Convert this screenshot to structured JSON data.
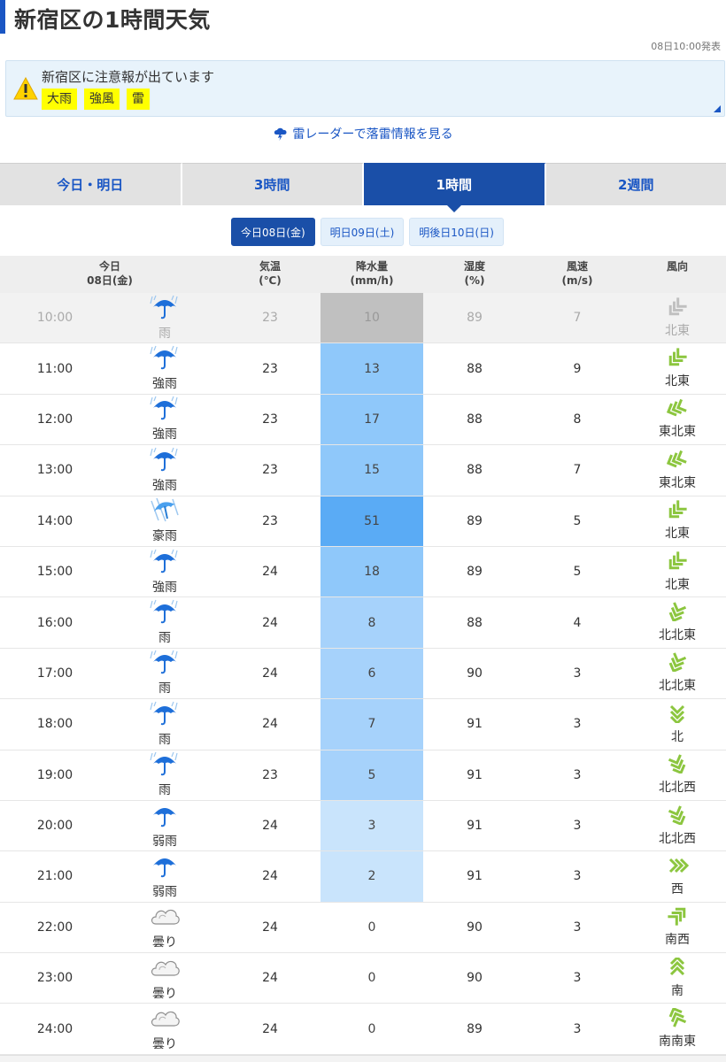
{
  "page": {
    "title": "新宿区の1時間天気",
    "issued": "08日10:00発表"
  },
  "alert": {
    "title": "新宿区に注意報が出ています",
    "tags": [
      "大雨",
      "強風",
      "雷"
    ]
  },
  "radar_link": "雷レーダーで落雷情報を見る",
  "tabs": [
    {
      "label": "今日・明日",
      "active": false
    },
    {
      "label": "3時間",
      "active": false
    },
    {
      "label": "1時間",
      "active": true
    },
    {
      "label": "2週間",
      "active": false
    }
  ],
  "days": [
    {
      "label": "今日08日(金)",
      "active": true
    },
    {
      "label": "明日09日(土)",
      "active": false
    },
    {
      "label": "明後日10日(日)",
      "active": false
    }
  ],
  "headers": {
    "time": "今日\n08日(金)",
    "temp": "気温\n(℃)",
    "precip": "降水量\n(mm/h)",
    "humidity": "湿度\n(%)",
    "wind_speed": "風速\n(m/s)",
    "wind_dir": "風向"
  },
  "colors": {
    "accent": "#1a56c4",
    "tab_active": "#1a4fa8",
    "alert_bg": "#e8f3fb",
    "tag_bg": "#ffff00",
    "precip_past": "#c0c0c0",
    "precip_heavy": "#5aabf5",
    "precip_strong": "#8fc8fa",
    "precip_medium": "#a6d2fb",
    "precip_light": "#c9e4fc",
    "wind_icon": "#8cc63f"
  },
  "rows": [
    {
      "time": "10:00",
      "weather": "雨",
      "icon": "umbrella-rain-icon",
      "temp": "23",
      "precip": "10",
      "humidity": "89",
      "wind_speed": "7",
      "wind_dir": "北東",
      "past": true
    },
    {
      "time": "11:00",
      "weather": "強雨",
      "icon": "umbrella-rain-icon",
      "temp": "23",
      "precip": "13",
      "humidity": "88",
      "wind_speed": "9",
      "wind_dir": "北東",
      "past": false
    },
    {
      "time": "12:00",
      "weather": "強雨",
      "icon": "umbrella-rain-icon",
      "temp": "23",
      "precip": "17",
      "humidity": "88",
      "wind_speed": "8",
      "wind_dir": "東北東",
      "past": false
    },
    {
      "time": "13:00",
      "weather": "強雨",
      "icon": "umbrella-rain-icon",
      "temp": "23",
      "precip": "15",
      "humidity": "88",
      "wind_speed": "7",
      "wind_dir": "東北東",
      "past": false
    },
    {
      "time": "14:00",
      "weather": "豪雨",
      "icon": "umbrella-storm-icon",
      "temp": "23",
      "precip": "51",
      "humidity": "89",
      "wind_speed": "5",
      "wind_dir": "北東",
      "past": false
    },
    {
      "time": "15:00",
      "weather": "強雨",
      "icon": "umbrella-rain-icon",
      "temp": "24",
      "precip": "18",
      "humidity": "89",
      "wind_speed": "5",
      "wind_dir": "北東",
      "past": false
    },
    {
      "time": "16:00",
      "weather": "雨",
      "icon": "umbrella-rain-icon",
      "temp": "24",
      "precip": "8",
      "humidity": "88",
      "wind_speed": "4",
      "wind_dir": "北北東",
      "past": false
    },
    {
      "time": "17:00",
      "weather": "雨",
      "icon": "umbrella-rain-icon",
      "temp": "24",
      "precip": "6",
      "humidity": "90",
      "wind_speed": "3",
      "wind_dir": "北北東",
      "past": false
    },
    {
      "time": "18:00",
      "weather": "雨",
      "icon": "umbrella-rain-icon",
      "temp": "24",
      "precip": "7",
      "humidity": "91",
      "wind_speed": "3",
      "wind_dir": "北",
      "past": false
    },
    {
      "time": "19:00",
      "weather": "雨",
      "icon": "umbrella-rain-icon",
      "temp": "23",
      "precip": "5",
      "humidity": "91",
      "wind_speed": "3",
      "wind_dir": "北北西",
      "past": false
    },
    {
      "time": "20:00",
      "weather": "弱雨",
      "icon": "umbrella-icon",
      "temp": "24",
      "precip": "3",
      "humidity": "91",
      "wind_speed": "3",
      "wind_dir": "北北西",
      "past": false
    },
    {
      "time": "21:00",
      "weather": "弱雨",
      "icon": "umbrella-icon",
      "temp": "24",
      "precip": "2",
      "humidity": "91",
      "wind_speed": "3",
      "wind_dir": "西",
      "past": false
    },
    {
      "time": "22:00",
      "weather": "曇り",
      "icon": "cloud-icon",
      "temp": "24",
      "precip": "0",
      "humidity": "90",
      "wind_speed": "3",
      "wind_dir": "南西",
      "past": false
    },
    {
      "time": "23:00",
      "weather": "曇り",
      "icon": "cloud-icon",
      "temp": "24",
      "precip": "0",
      "humidity": "90",
      "wind_speed": "3",
      "wind_dir": "南",
      "past": false
    },
    {
      "time": "24:00",
      "weather": "曇り",
      "icon": "cloud-icon",
      "temp": "24",
      "precip": "0",
      "humidity": "89",
      "wind_speed": "3",
      "wind_dir": "南南東",
      "past": false
    }
  ]
}
